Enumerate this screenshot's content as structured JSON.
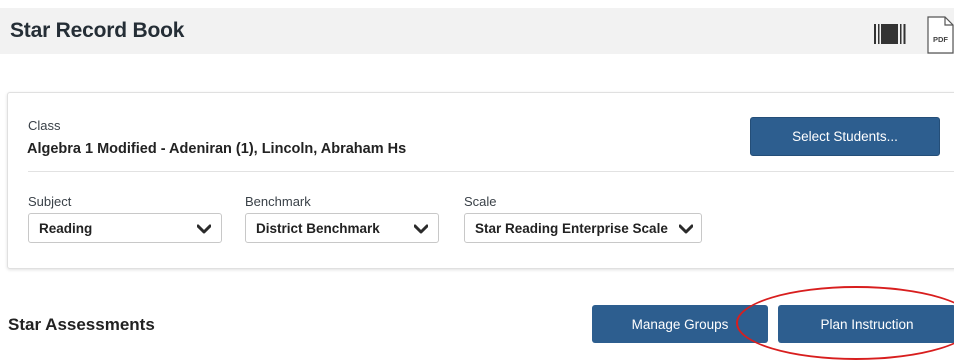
{
  "header": {
    "title": "Star Record Book",
    "pdf_icon_text": "PDF"
  },
  "class_section": {
    "label": "Class",
    "value": "Algebra 1 Modified - Adeniran (1), Lincoln, Abraham Hs",
    "select_students_label": "Select Students..."
  },
  "filters": {
    "subject": {
      "label": "Subject",
      "value": "Reading"
    },
    "benchmark": {
      "label": "Benchmark",
      "value": "District Benchmark"
    },
    "scale": {
      "label": "Scale",
      "value": "Star Reading Enterprise Scale"
    }
  },
  "assessments": {
    "title": "Star Assessments",
    "manage_groups_label": "Manage Groups",
    "plan_instruction_label": "Plan Instruction"
  },
  "colors": {
    "primary_button": "#2d5e8f",
    "annotation": "#d81e1e"
  }
}
